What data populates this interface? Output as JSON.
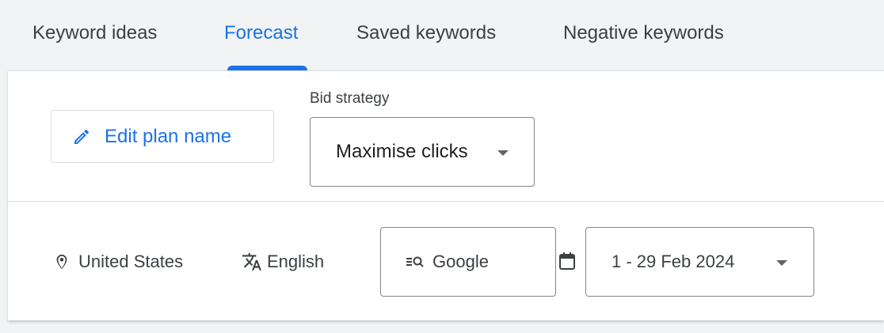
{
  "tabs": [
    {
      "label": "Keyword ideas",
      "active": false
    },
    {
      "label": "Forecast",
      "active": true
    },
    {
      "label": "Saved keywords",
      "active": false
    },
    {
      "label": "Negative keywords",
      "active": false
    }
  ],
  "toolbar": {
    "edit_plan_label": "Edit plan name",
    "bid_strategy_label": "Bid strategy",
    "bid_strategy_value": "Maximise clicks"
  },
  "filters": {
    "location": "United States",
    "language": "English",
    "network": "Google",
    "date_range": "1 - 29 Feb 2024"
  },
  "icons": {
    "edit": "pencil-icon",
    "location": "location-pin-icon",
    "language": "translate-icon",
    "network": "search-network-icon",
    "date": "calendar-icon",
    "dropdown": "caret-down-icon"
  },
  "colors": {
    "accent": "#1a73e8",
    "text": "#3c4043",
    "background": "#f1f3f4",
    "panel": "#ffffff",
    "border": "#dadce0"
  }
}
